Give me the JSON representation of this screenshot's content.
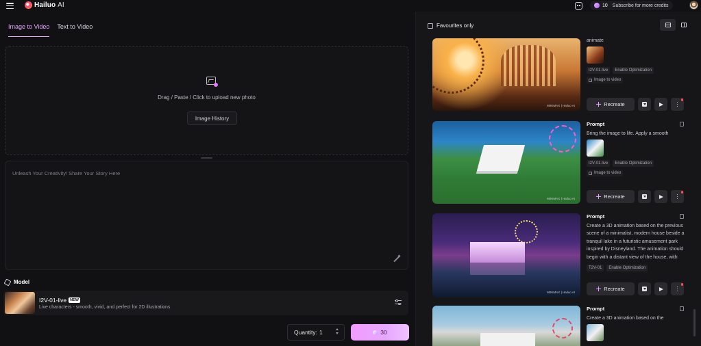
{
  "header": {
    "logo_text": "Hailuo",
    "logo_suffix": "AI",
    "credits": "10",
    "subscribe_label": "Subscribe for more credits"
  },
  "left": {
    "tabs": [
      {
        "label": "Image to Video",
        "active": true
      },
      {
        "label": "Text to Video",
        "active": false
      }
    ],
    "upload_text": "Drag / Paste / Click to upload new photo",
    "image_history_label": "Image History",
    "prompt_placeholder": "Unleash Your Creativity! Share Your Story Here",
    "model_section_label": "Model",
    "model": {
      "name": "I2V-01-live",
      "badge": "NEW",
      "description": "Live characters - smooth, vivid, and perfect for 2D illustrations"
    },
    "quantity_label": "Quantity:",
    "quantity_value": "1",
    "generate_cost": "30",
    "accent_color": "#e7a7ff"
  },
  "right": {
    "favourites_label": "Favourites only",
    "cards": [
      {
        "prompt_tail": "animate",
        "tags": [
          "I2V-01-live",
          "Enable Optimization"
        ],
        "mode": "Image to video",
        "recreate_label": "Recreate",
        "watermark": "MINIMAX | Hailuo AI"
      },
      {
        "prompt_title": "Prompt",
        "prompt_text": "Bring the image to life. Apply a smooth",
        "tags": [
          "I2V-01-live",
          "Enable Optimization"
        ],
        "mode": "Image to video",
        "recreate_label": "Recreate",
        "watermark": "MINIMAX | Hailuo AI"
      },
      {
        "prompt_title": "Prompt",
        "prompt_text": "Create a 3D animation based on the previous scene of a minimalist, modern house beside a tranquil lake in a futuristic amusement park inspired by Disneyland. The animation should begin with a distant view of the house, with clean lines, large",
        "tags": [
          "T2V-01",
          "Enable Optimization"
        ],
        "recreate_label": "Recreate",
        "watermark": "MINIMAX | Hailuo AI"
      },
      {
        "prompt_title": "Prompt",
        "prompt_text": "Create a 3D animation based on the"
      }
    ]
  }
}
